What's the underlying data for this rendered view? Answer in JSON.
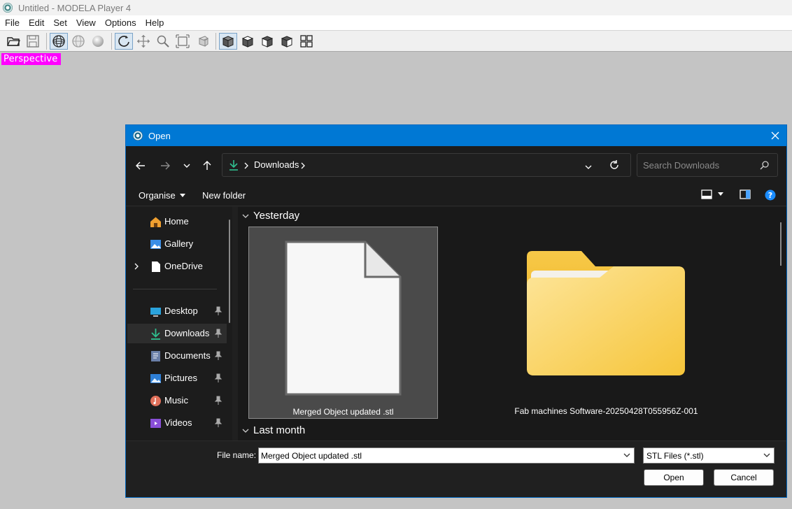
{
  "app": {
    "title": "Untitled - MODELA Player 4",
    "menu": [
      "File",
      "Edit",
      "Set",
      "View",
      "Options",
      "Help"
    ],
    "viewport_label": "Perspective",
    "toolbar_icons": [
      "open-folder-icon",
      "save-icon",
      "wireframe-sphere-icon",
      "hidden-line-sphere-icon",
      "shaded-sphere-icon",
      "rotate-icon",
      "pan-icon",
      "zoom-icon",
      "fit-view-icon",
      "zoom-box-icon",
      "front-view-cube-icon",
      "top-view-cube-icon",
      "side-view-cube-icon",
      "iso-view-cube-icon",
      "multi-view-icon"
    ]
  },
  "dialog": {
    "title": "Open",
    "address": {
      "location": "Downloads"
    },
    "search": {
      "placeholder": "Search Downloads"
    },
    "commands": {
      "organise": "Organise",
      "new_folder": "New folder"
    },
    "nav_items": [
      {
        "label": "Home",
        "icon": "home-icon",
        "pinned": false,
        "expandable": false
      },
      {
        "label": "Gallery",
        "icon": "gallery-icon",
        "pinned": false,
        "expandable": false
      },
      {
        "label": "OneDrive",
        "icon": "document-icon",
        "pinned": false,
        "expandable": true
      },
      {
        "label": "Desktop",
        "icon": "desktop-icon",
        "pinned": true,
        "expandable": false
      },
      {
        "label": "Downloads",
        "icon": "download-icon",
        "pinned": true,
        "expandable": false,
        "selected": true
      },
      {
        "label": "Documents",
        "icon": "documents-icon",
        "pinned": true,
        "expandable": false
      },
      {
        "label": "Pictures",
        "icon": "pictures-icon",
        "pinned": true,
        "expandable": false
      },
      {
        "label": "Music",
        "icon": "music-icon",
        "pinned": true,
        "expandable": false
      },
      {
        "label": "Videos",
        "icon": "videos-icon",
        "pinned": true,
        "expandable": false
      }
    ],
    "groups": [
      {
        "label": "Yesterday",
        "items": [
          {
            "name": "Merged Object updated .stl",
            "type": "file",
            "selected": true
          },
          {
            "name": "Fab machines Software-20250428T055956Z-001",
            "type": "folder",
            "selected": false
          }
        ]
      },
      {
        "label": "Last month",
        "items": []
      }
    ],
    "file_name": {
      "label": "File name:",
      "value": "Merged Object updated .stl"
    },
    "file_type": {
      "value": "STL Files (*.stl)"
    },
    "buttons": {
      "open": "Open",
      "cancel": "Cancel"
    }
  },
  "colors": {
    "dialog_title": "#0078d4",
    "dialog_bg": "#202020",
    "viewport_label": "#ff00ff",
    "folder_yellow": "#f7c948"
  }
}
